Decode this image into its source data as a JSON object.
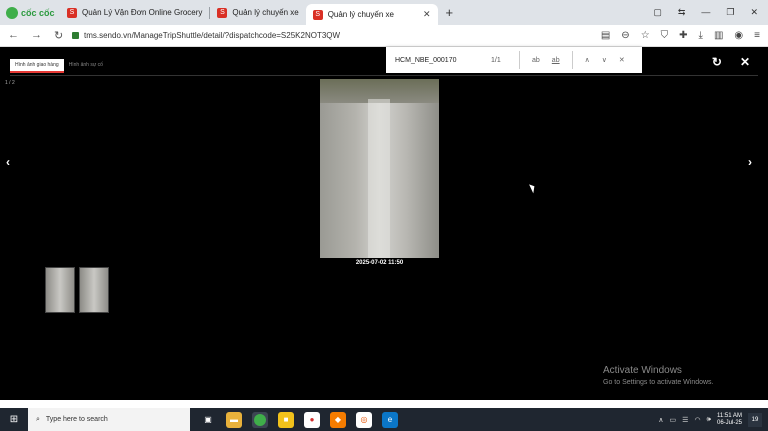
{
  "browser": {
    "brand": "cốc cốc",
    "tabs": [
      {
        "label": "Quản Lý Vận Đơn Online Grocery"
      },
      {
        "label": "Quản lý chuyến xe"
      },
      {
        "label": "Quản lý chuyến xe",
        "active": true
      }
    ],
    "url": "tms.sendo.vn/ManageTripShuttle/detail/?dispatchcode=S25K2NOT3QW"
  },
  "viewer": {
    "tabs": [
      {
        "label": "Hình ảnh giao hàng",
        "active": true
      },
      {
        "label": "Hình ảnh sự cố"
      }
    ],
    "counter": "1 / 2",
    "photo_caption": "2025-07-02 11:50",
    "thumbnails": 2
  },
  "find": {
    "query": "HCM_NBE_000170",
    "count": "1/1",
    "case_label": "ab",
    "word_label": "ab"
  },
  "watermark": {
    "title": "Activate Windows",
    "subtitle": "Go to Settings to activate Windows."
  },
  "taskbar": {
    "search_placeholder": "Type here to search",
    "time": "11:51 AM",
    "date": "06-Jul-25",
    "notification_count": "19"
  }
}
